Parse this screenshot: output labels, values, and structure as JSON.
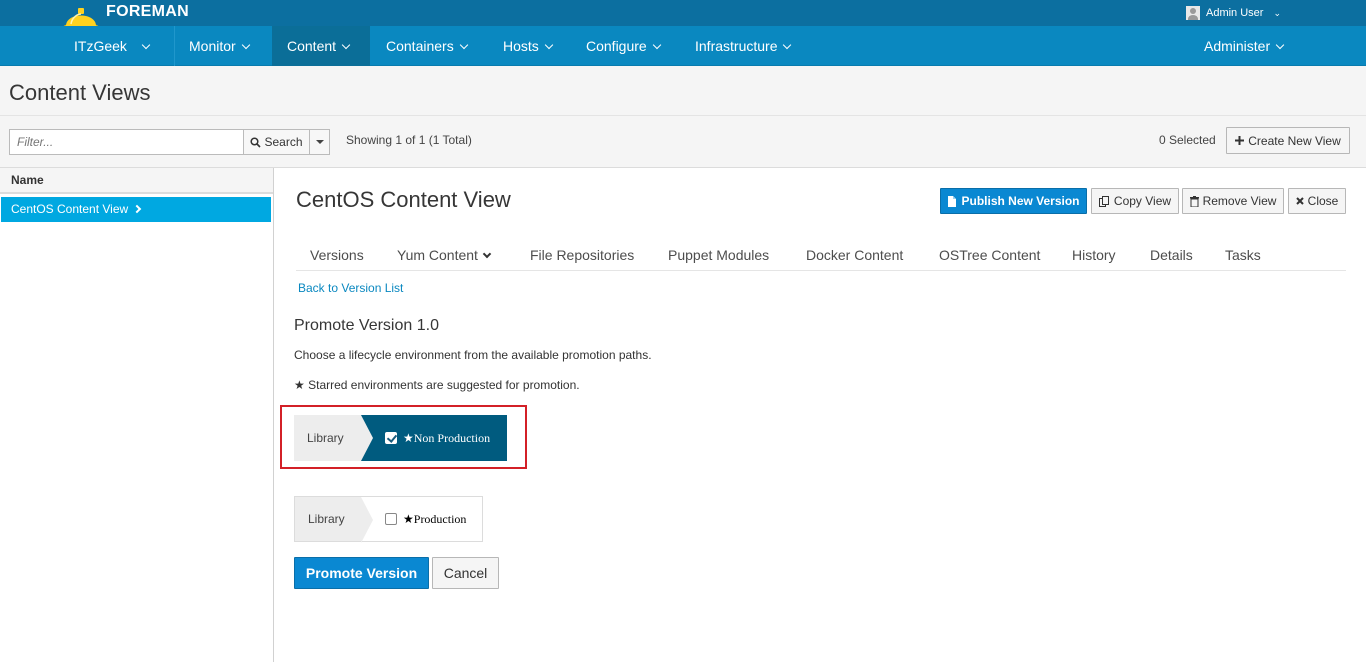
{
  "brand": {
    "name": "FOREMAN",
    "logo_icon": "helmet-icon"
  },
  "user": {
    "name": "Admin User"
  },
  "nav": {
    "org": "ITzGeek",
    "items": [
      "Monitor",
      "Content",
      "Containers",
      "Hosts",
      "Configure",
      "Infrastructure"
    ],
    "active": "Content",
    "admin": "Administer"
  },
  "page": {
    "title": "Content Views"
  },
  "toolbar": {
    "filter_placeholder": "Filter...",
    "search_label": "Search",
    "showing": "Showing 1 of 1 (1 Total)",
    "selected": "0 Selected",
    "create_label": "Create New View"
  },
  "list": {
    "header": "Name",
    "rows": [
      "CentOS Content View"
    ]
  },
  "content_view": {
    "title": "CentOS Content View",
    "actions": {
      "publish": "Publish New Version",
      "copy": "Copy View",
      "remove": "Remove View",
      "close": "Close"
    },
    "tabs": [
      "Versions",
      "Yum Content",
      "File Repositories",
      "Puppet Modules",
      "Docker Content",
      "OSTree Content",
      "History",
      "Details",
      "Tasks"
    ]
  },
  "promote": {
    "back_link": "Back to Version List",
    "heading": "Promote Version 1.0",
    "instructions": "Choose a lifecycle environment from the available promotion paths.",
    "starred_note": "Starred environments are suggested for promotion.",
    "paths": [
      {
        "library": "Library",
        "environment": "Non Production",
        "checked": true
      },
      {
        "library": "Library",
        "environment": "Production",
        "checked": false
      }
    ],
    "promote_label": "Promote Version",
    "cancel_label": "Cancel"
  },
  "colors": {
    "topbar": "#0c6fa0",
    "navbar": "#0a88c0",
    "primary": "#0a88d2",
    "selected_row": "#00a8e1",
    "selected_env": "#005b7f",
    "highlight": "#d32027"
  }
}
